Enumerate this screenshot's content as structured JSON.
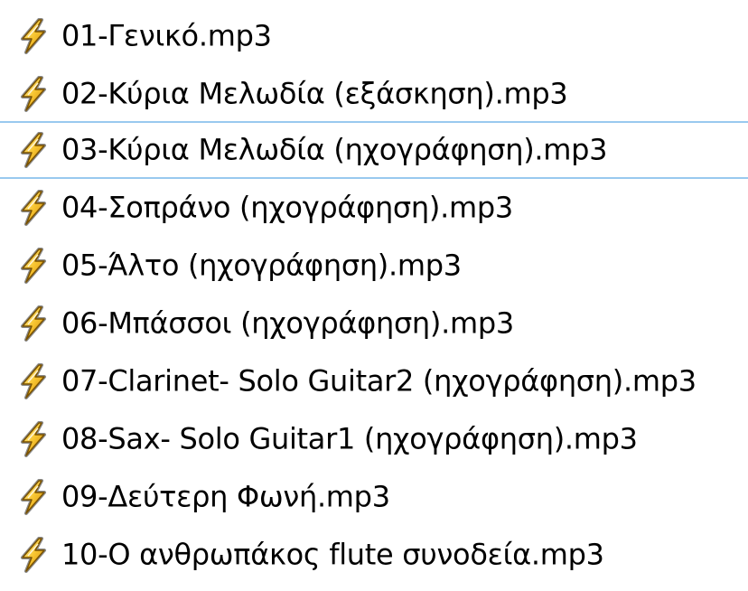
{
  "file_list": {
    "icon": "winamp-audio-file-icon",
    "focus_border_color": "#99c9ef",
    "items": [
      {
        "name": "01-Γενικό.mp3",
        "focused": false
      },
      {
        "name": "02-Κύρια Μελωδία (εξάσκηση).mp3",
        "focused": false
      },
      {
        "name": "03-Κύρια Μελωδία (ηχογράφηση).mp3",
        "focused": true
      },
      {
        "name": "04-Σοπράνο (ηχογράφηση).mp3",
        "focused": false
      },
      {
        "name": "05-Άλτο (ηχογράφηση).mp3",
        "focused": false
      },
      {
        "name": "06-Μπάσσοι (ηχογράφηση).mp3",
        "focused": false
      },
      {
        "name": "07-Clarinet- Solo Guitar2 (ηχογράφηση).mp3",
        "focused": false
      },
      {
        "name": "08-Sax- Solo Guitar1 (ηχογράφηση).mp3",
        "focused": false
      },
      {
        "name": "09-Δεύτερη Φωνή.mp3",
        "focused": false
      },
      {
        "name": "10-Ο ανθρωπάκος flute συνοδεία.mp3",
        "focused": false
      }
    ]
  }
}
